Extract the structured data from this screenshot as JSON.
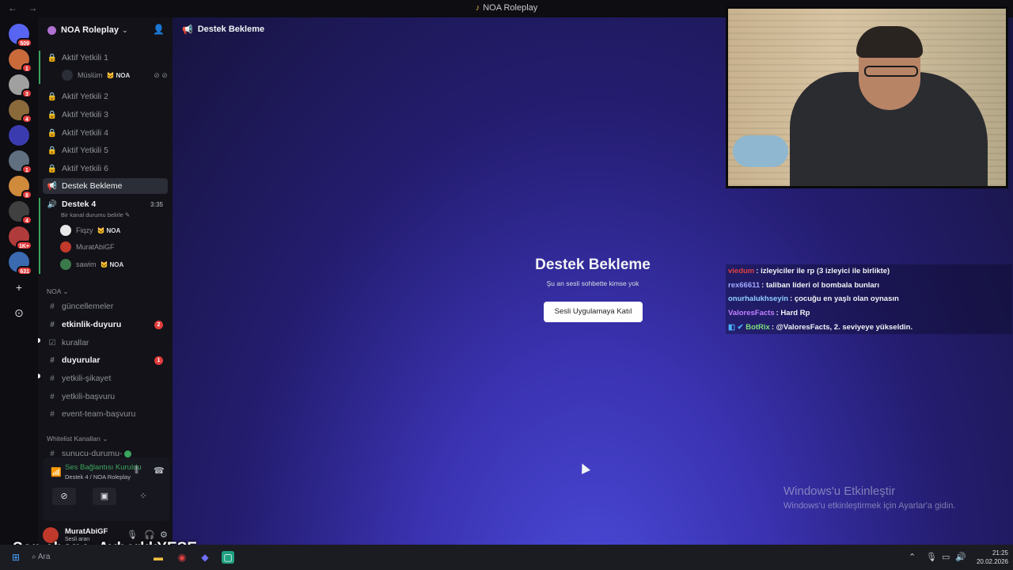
{
  "window": {
    "title": "NOA Roleplay",
    "back": "←",
    "forward": "→"
  },
  "servers": [
    {
      "badge": "509",
      "color": "#5865f2"
    },
    {
      "badge": "1",
      "color": "#c96a3b"
    },
    {
      "badge": "3",
      "color": "#a0a0a0"
    },
    {
      "badge": "4",
      "color": "#8a6a3b"
    },
    {
      "badge": "",
      "color": "#3b3bb0"
    },
    {
      "badge": "1",
      "color": "#607080"
    },
    {
      "badge": "8",
      "color": "#d08a3b"
    },
    {
      "badge": "4",
      "color": "#404040"
    },
    {
      "badge": "1K+",
      "color": "#b03b3b"
    },
    {
      "badge": "631",
      "color": "#3b6ab0"
    }
  ],
  "sidebar": {
    "guild_name": "NOA Roleplay",
    "channels": {
      "aktif1": "Aktif Yetkili 1",
      "aktif2": "Aktif Yetkili 2",
      "aktif3": "Aktif Yetkili 3",
      "aktif4": "Aktif Yetkili 4",
      "aktif5": "Aktif Yetkili 5",
      "aktif6": "Aktif Yetkili 6",
      "destek_bekleme": "Destek Bekleme",
      "destek4": "Destek 4",
      "destek4_time": "3:35",
      "destek4_status": "Bir kanal durumu belirle"
    },
    "voice_users": {
      "muslum": "Müslüm",
      "fiqzy": "Fiqzy",
      "murat": "MuratAbiGF",
      "sawim": "sawim",
      "noa_tag": "NOA"
    },
    "category_noa": "NOA",
    "text_channels": {
      "guncellemeler": "güncellemeler",
      "etkinlik": "etkinlik-duyuru",
      "etkinlik_badge": "2",
      "kurallar": "kurallar",
      "duyurular": "duyurular",
      "duyurular_badge": "1",
      "sikayet": "yetkili-şikayet",
      "basvuru": "yetkili-başvuru",
      "event": "event-team-başvuru"
    },
    "category_whitelist": "Whitelist Kanalları",
    "sunucu": "sunucu-durumu-"
  },
  "voice_panel": {
    "status": "Ses Bağlantısı Kuruldu",
    "sub": "Destek 4 / NOA Roleplay"
  },
  "user": {
    "name": "MuratAbiGF",
    "status": "Sesli aran"
  },
  "main": {
    "header_title": "Destek Bekleme",
    "title": "Destek Bekleme",
    "subtitle": "Şu an sesli sohbette kimse yok",
    "join_button": "Sesli Uygulamaya Katıl",
    "watermark_title": "Windows'u Etkinleştir",
    "watermark_sub": "Windows'u etkinleştirmek için Ayarlar'a gidin."
  },
  "chat": [
    {
      "user": "viedum",
      "text": ": izleyiciler ile rp (3 izleyici ile birlikte)",
      "color": "#e04040"
    },
    {
      "user": "rex66611",
      "text": ": taliban lideri ol bombala bunları",
      "color": "#a0a8ff"
    },
    {
      "user": "onurhalukhseyin",
      "text": ": çocuğu en yaşlı olan oynasın",
      "color": "#8fd0ff"
    },
    {
      "user": "ValoresFacts",
      "text": ": Hard Rp",
      "color": "#c080ff"
    },
    {
      "user": "BotRix",
      "text": ": @ValoresFacts, 2. seviyeye yükseldin.",
      "color": "#7be07b"
    }
  ],
  "overlay": {
    "son_abone": "Son abone: AyberkkYESE"
  },
  "taskbar": {
    "search": "Ara",
    "time": "21:25",
    "date": "20.02.2026"
  }
}
